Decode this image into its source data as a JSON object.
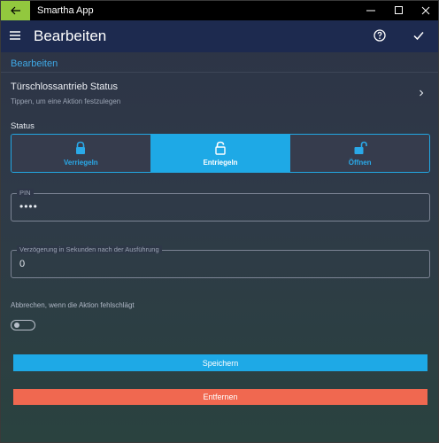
{
  "window": {
    "title": "Smartha App"
  },
  "appbar": {
    "title": "Bearbeiten",
    "icons": {
      "menu": "hamburger-icon",
      "help": "help-icon",
      "confirm": "check-icon"
    }
  },
  "section": {
    "title": "Bearbeiten"
  },
  "device_row": {
    "title": "Türschlossantrieb Status",
    "subtitle": "Tippen, um eine Aktion festzulegen"
  },
  "status": {
    "label": "Status",
    "selected": "Entriegeln",
    "options": [
      {
        "label": "Verriegeln",
        "icon": "lock-closed-icon"
      },
      {
        "label": "Entriegeln",
        "icon": "lock-open-icon"
      },
      {
        "label": "Öffnen",
        "icon": "lock-unlatched-icon"
      }
    ]
  },
  "pin": {
    "label": "PIN",
    "value": "••••"
  },
  "delay": {
    "label": "Verzögerung in Sekunden nach der Ausführung",
    "value": "0"
  },
  "abort": {
    "label": "Abbrechen, wenn die Aktion fehlschlägt",
    "enabled": false
  },
  "actions": {
    "save": "Speichern",
    "remove": "Entfernen"
  },
  "colors": {
    "accent": "#1ea9e6",
    "danger": "#f06850",
    "back_button": "#92c83e",
    "appbar": "#1d2a4f"
  }
}
